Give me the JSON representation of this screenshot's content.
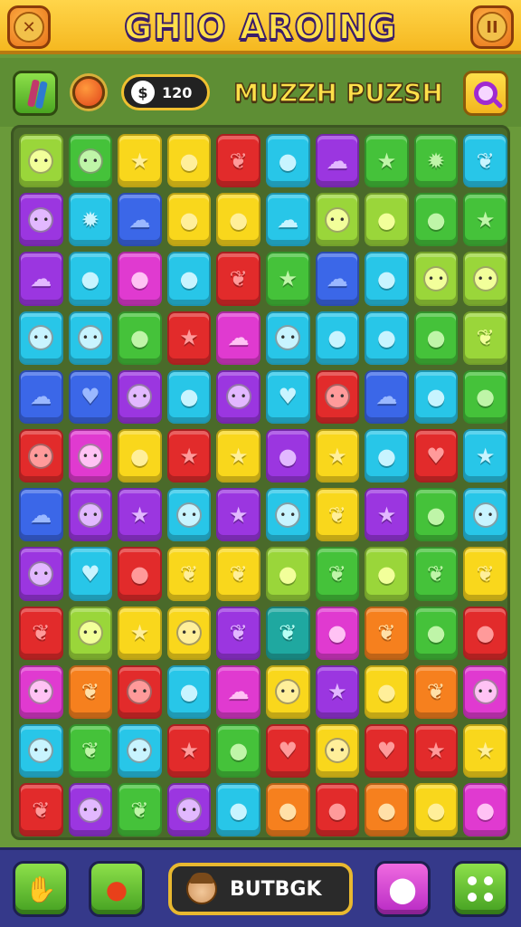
{
  "header": {
    "title": "GHIO AROING",
    "close_icon": "x-icon",
    "pause_label": "II"
  },
  "hud": {
    "coins_value": "120",
    "coins_symbol": "$",
    "level_name": "MUZZH PUZSH"
  },
  "colors": {
    "yellow": "#f9d71c",
    "red": "#e22b2b",
    "blue": "#3b67e8",
    "cyan": "#28c6e8",
    "green": "#45c23a",
    "lime": "#9ad63a",
    "purple": "#9b36e0",
    "magenta": "#e03ad0",
    "orange": "#f6801e",
    "teal": "#1fa8a0"
  },
  "board": {
    "rows": 12,
    "cols": 10,
    "tiles": [
      [
        "lime:face",
        "green:face",
        "yellow:star",
        "yellow:fruit",
        "red:leaf",
        "cyan:fruit",
        "purple:cloud",
        "green:star",
        "green:gear",
        "cyan:leaf"
      ],
      [
        "purple:face",
        "cyan:gear",
        "blue:cloud",
        "yellow:fruit",
        "yellow:fruit",
        "cyan:cloud",
        "lime:face",
        "lime:fruit",
        "green:fruit",
        "green:star"
      ],
      [
        "purple:cloud",
        "cyan:fruit",
        "magenta:fruit",
        "cyan:fruit",
        "red:leaf",
        "green:star",
        "blue:cloud",
        "cyan:fruit",
        "lime:face",
        "lime:face"
      ],
      [
        "cyan:face",
        "cyan:face",
        "green:fruit",
        "red:star",
        "magenta:cloud",
        "cyan:face",
        "cyan:fruit",
        "cyan:fruit",
        "green:fruit",
        "lime:leaf"
      ],
      [
        "blue:cloud",
        "blue:heart",
        "purple:face",
        "cyan:fruit",
        "purple:face",
        "cyan:heart",
        "red:face",
        "blue:cloud",
        "cyan:fruit",
        "green:fruit"
      ],
      [
        "red:face",
        "magenta:face",
        "yellow:fruit",
        "red:star",
        "yellow:star",
        "purple:fruit",
        "yellow:star",
        "cyan:fruit",
        "red:heart",
        "cyan:star"
      ],
      [
        "blue:cloud",
        "purple:face",
        "purple:star",
        "cyan:face",
        "purple:star",
        "cyan:face",
        "yellow:leaf",
        "purple:star",
        "green:fruit",
        "cyan:face"
      ],
      [
        "purple:face",
        "cyan:heart",
        "red:fruit",
        "yellow:leaf",
        "yellow:leaf",
        "lime:fruit",
        "green:leaf",
        "lime:fruit",
        "green:leaf",
        "yellow:leaf"
      ],
      [
        "red:leaf",
        "lime:face",
        "yellow:star",
        "yellow:face",
        "purple:leaf",
        "teal:leaf",
        "magenta:fruit",
        "orange:leaf",
        "green:fruit",
        "red:fruit"
      ],
      [
        "magenta:face",
        "orange:leaf",
        "red:face",
        "cyan:fruit",
        "magenta:cloud",
        "yellow:face",
        "purple:star",
        "yellow:fruit",
        "orange:leaf",
        "magenta:face"
      ],
      [
        "cyan:face",
        "green:leaf",
        "cyan:face",
        "red:star",
        "green:fruit",
        "red:heart",
        "yellow:face",
        "red:heart",
        "red:star",
        "yellow:star"
      ],
      [
        "red:leaf",
        "purple:face",
        "green:leaf",
        "purple:face",
        "cyan:fruit",
        "orange:fruit",
        "red:fruit",
        "orange:fruit",
        "yellow:fruit",
        "magenta:fruit"
      ]
    ]
  },
  "glyphs": {
    "face": "• •",
    "star": "★",
    "fruit": "●",
    "leaf": "❦",
    "cloud": "☁",
    "heart": "♥",
    "gear": "✹"
  },
  "bottom": {
    "main_label": "BUTBGK",
    "btn1_icon": "hand-icon",
    "btn2_icon": "chat-bubble-icon",
    "btn4_icon": "location-pin-icon",
    "btn5_icon": "dice-icon"
  }
}
